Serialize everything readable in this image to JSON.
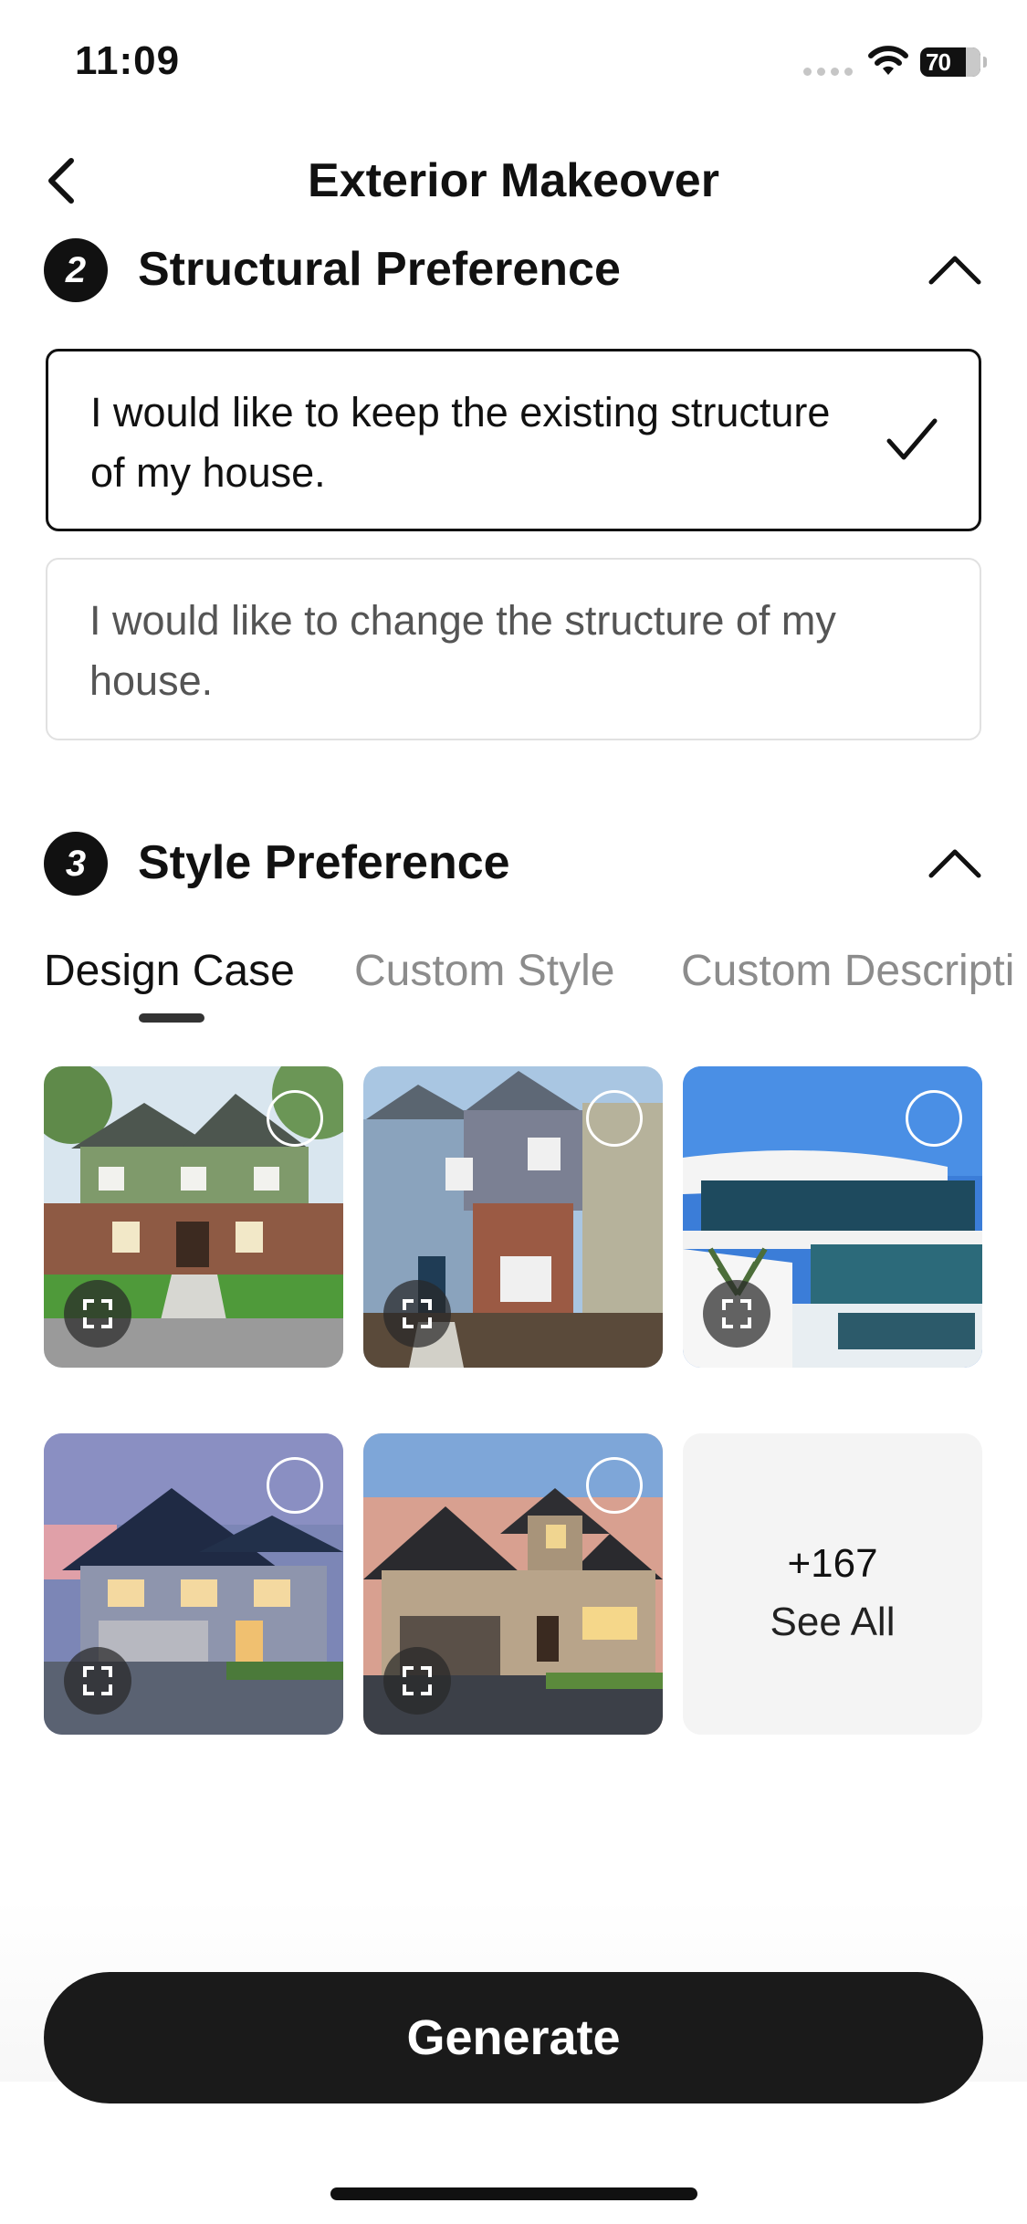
{
  "status_bar": {
    "time": "11:09",
    "battery": "70"
  },
  "nav": {
    "title": "Exterior Makeover",
    "back_icon": "chevron-left-icon"
  },
  "structural_section": {
    "number": "2",
    "title": "Structural Preference",
    "collapse_icon": "chevron-up-icon",
    "options": [
      {
        "label": "I would like to keep the existing structure of my house.",
        "selected": true
      },
      {
        "label": "I would like to change the structure of my house.",
        "selected": false
      }
    ]
  },
  "style_section": {
    "number": "3",
    "title": "Style Preference",
    "collapse_icon": "chevron-up-icon",
    "tabs": [
      {
        "label": "Design Case",
        "active": true
      },
      {
        "label": "Custom Style",
        "active": false
      },
      {
        "label": "Custom Descripti",
        "active": false
      }
    ],
    "see_all": {
      "count": "+167",
      "label": "See All"
    }
  },
  "generate_label": "Generate",
  "colors": {
    "accent": "#1a1a1a",
    "inactive_tab": "#8c8c8c",
    "border": "#e1e1e1"
  }
}
